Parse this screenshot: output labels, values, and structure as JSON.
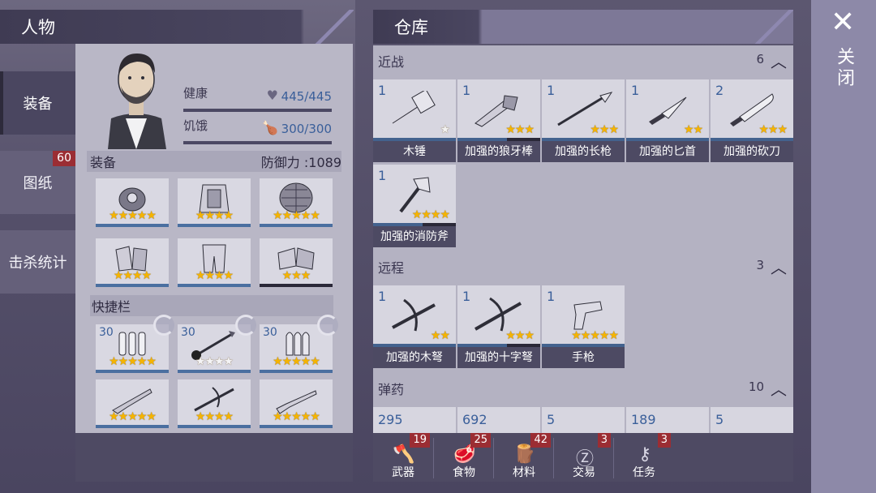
{
  "character": {
    "title": "人物",
    "tabs": [
      {
        "label": "装备",
        "active": true
      },
      {
        "label": "图纸",
        "badge": "60"
      },
      {
        "label": "击杀统计"
      }
    ],
    "stats": {
      "health_label": "健康",
      "health_value": "445/445",
      "hunger_label": "饥饿",
      "hunger_value": "300/300"
    },
    "equipment_label": "装备",
    "defense_label": "防御力 :1089",
    "equipment_slots": [
      {
        "icon": "helmet-icon",
        "stars": "★★★★★"
      },
      {
        "icon": "armor-vest-icon",
        "stars": "★★★★"
      },
      {
        "icon": "shield-back-icon",
        "stars": "★★★★★"
      },
      {
        "icon": "gloves-icon",
        "stars": "★★★★"
      },
      {
        "icon": "pants-icon",
        "stars": "★★★★"
      },
      {
        "icon": "boots-icon",
        "stars": "★★★"
      }
    ],
    "hotbar_label": "快捷栏",
    "hotbar_slots": [
      {
        "icon": "bullets-icon",
        "count": "30",
        "stars": "★★★★★"
      },
      {
        "icon": "crossbow-bolt-icon",
        "count": "30",
        "stars": "★★★★"
      },
      {
        "icon": "rifle-bullets-icon",
        "count": "30",
        "stars": "★★★★★"
      },
      {
        "icon": "shotgun-icon",
        "stars": "★★★★★"
      },
      {
        "icon": "crossbow-icon",
        "stars": "★★★★"
      },
      {
        "icon": "rifle-icon",
        "stars": "★★★★★"
      }
    ]
  },
  "warehouse": {
    "title": "仓库",
    "melee": {
      "label": "近战",
      "count": "6",
      "items": [
        {
          "num": "1",
          "name": "木锤",
          "stars": "★",
          "icon": "hammer-icon"
        },
        {
          "num": "1",
          "name": "加强的狼牙棒",
          "stars": "★★★",
          "icon": "spiked-club-icon"
        },
        {
          "num": "1",
          "name": "加强的长枪",
          "stars": "★★★",
          "icon": "spear-icon"
        },
        {
          "num": "1",
          "name": "加强的匕首",
          "stars": "★★",
          "icon": "dagger-icon"
        },
        {
          "num": "2",
          "name": "加强的砍刀",
          "stars": "★★★",
          "icon": "machete-icon"
        },
        {
          "num": "1",
          "name": "加强的消防斧",
          "stars": "★★★★",
          "icon": "fire-axe-icon"
        }
      ]
    },
    "ranged": {
      "label": "远程",
      "count": "3",
      "items": [
        {
          "num": "1",
          "name": "加强的木弩",
          "stars": "★★",
          "icon": "wooden-crossbow-icon"
        },
        {
          "num": "1",
          "name": "加强的十字弩",
          "stars": "★★★",
          "icon": "crossbow-icon"
        },
        {
          "num": "1",
          "name": "手枪",
          "stars": "★★★★★",
          "icon": "pistol-icon"
        }
      ]
    },
    "ammo": {
      "label": "弹药",
      "count": "10",
      "items": [
        {
          "num": "295"
        },
        {
          "num": "692"
        },
        {
          "num": "5"
        },
        {
          "num": "189"
        },
        {
          "num": "5"
        }
      ]
    }
  },
  "bottom_nav": [
    {
      "label": "武器",
      "badge": "19",
      "icon": "axe-icon"
    },
    {
      "label": "食物",
      "badge": "25",
      "icon": "steak-icon"
    },
    {
      "label": "材料",
      "badge": "42",
      "icon": "logs-icon"
    },
    {
      "label": "交易",
      "badge": "3",
      "icon": "coin-icon"
    },
    {
      "label": "任务",
      "badge": "3",
      "icon": "key-icon"
    }
  ],
  "close": {
    "label": "关闭"
  },
  "colors": {
    "star": "#f5b400",
    "badge": "#9b2d33",
    "value_blue": "#3a5f9a"
  }
}
